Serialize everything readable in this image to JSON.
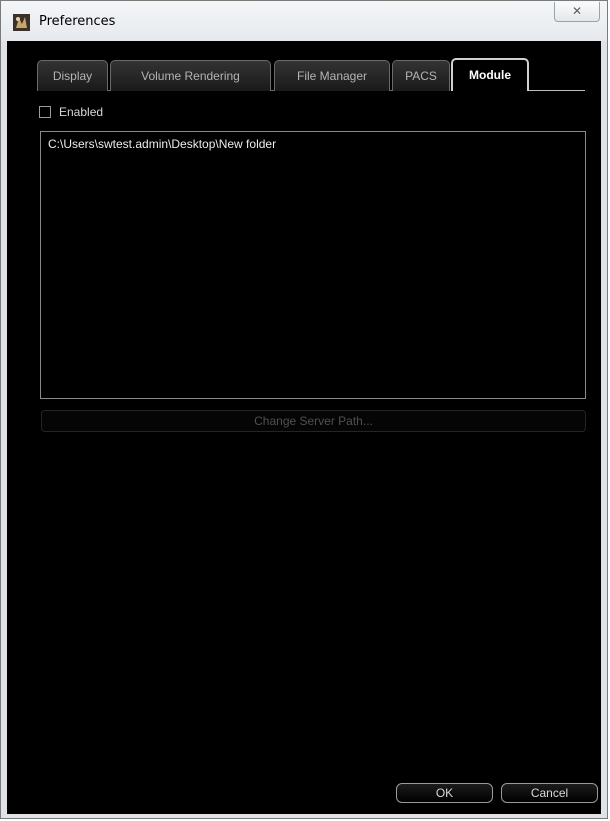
{
  "window": {
    "title": "Preferences",
    "close_glyph": "✕"
  },
  "tabs": [
    {
      "label": "Display",
      "active": false
    },
    {
      "label": "Volume Rendering",
      "active": false
    },
    {
      "label": "File Manager",
      "active": false
    },
    {
      "label": "PACS",
      "active": false
    },
    {
      "label": "Module",
      "active": true
    }
  ],
  "module": {
    "enabled_label": "Enabled",
    "enabled_checked": false,
    "paths": [
      "C:\\Users\\swtest.admin\\Desktop\\New folder"
    ],
    "change_path_label": "Change Server Path...",
    "change_path_enabled": false
  },
  "footer": {
    "ok_label": "OK",
    "cancel_label": "Cancel"
  },
  "colors": {
    "client_background": "#000000",
    "text": "#d8d8d8",
    "disabled_text": "#505050"
  }
}
